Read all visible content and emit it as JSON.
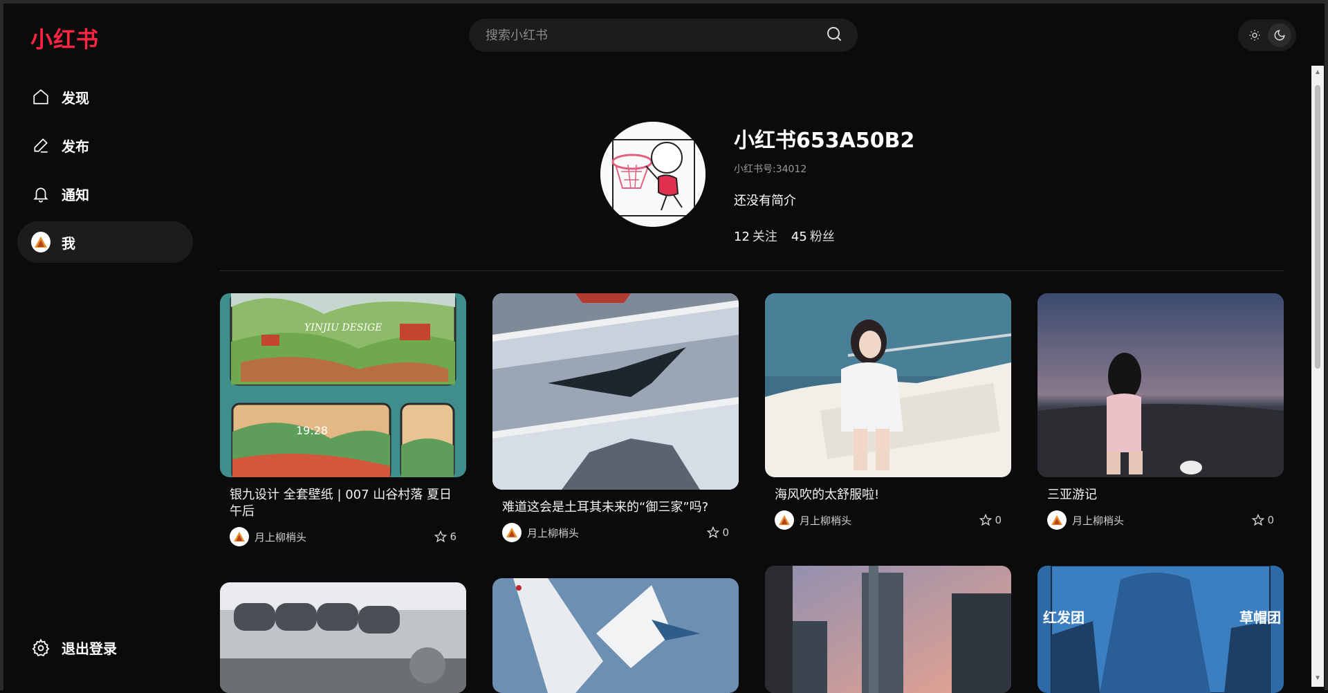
{
  "app": {
    "logo": "小红书",
    "brand_color": "#ff2442"
  },
  "search": {
    "placeholder": "搜索小红书"
  },
  "nav": [
    {
      "label": "发现",
      "icon": "home-icon"
    },
    {
      "label": "发布",
      "icon": "pencil-icon"
    },
    {
      "label": "通知",
      "icon": "bell-icon"
    },
    {
      "label": "我",
      "icon": "avatar",
      "active": true
    }
  ],
  "logout": {
    "label": "退出登录",
    "icon": "gear-icon"
  },
  "profile": {
    "name": "小红书653A50B2",
    "id": "小红书号:34012",
    "bio": "还没有简介",
    "following_count": "12",
    "following_label": "关注",
    "followers_count": "45",
    "followers_label": "粉丝"
  },
  "notes": [
    {
      "title": "银九设计 全套壁纸 | 007 山谷村落 夏日午后",
      "author": "月上柳梢头",
      "likes": "6"
    },
    {
      "title": "难道这会是土耳其未来的“御三家”吗?",
      "author": "月上柳梢头",
      "likes": "0"
    },
    {
      "title": "海风吹的太舒服啦!",
      "author": "月上柳梢头",
      "likes": "0"
    },
    {
      "title": "三亚游记",
      "author": "月上柳梢头",
      "likes": "0"
    }
  ],
  "image_text": {
    "wallpaper_watermark": "YINJIU DESIGE",
    "wallpaper_clock": "19:28",
    "comic_left": "红发团",
    "comic_right": "草帽团"
  }
}
